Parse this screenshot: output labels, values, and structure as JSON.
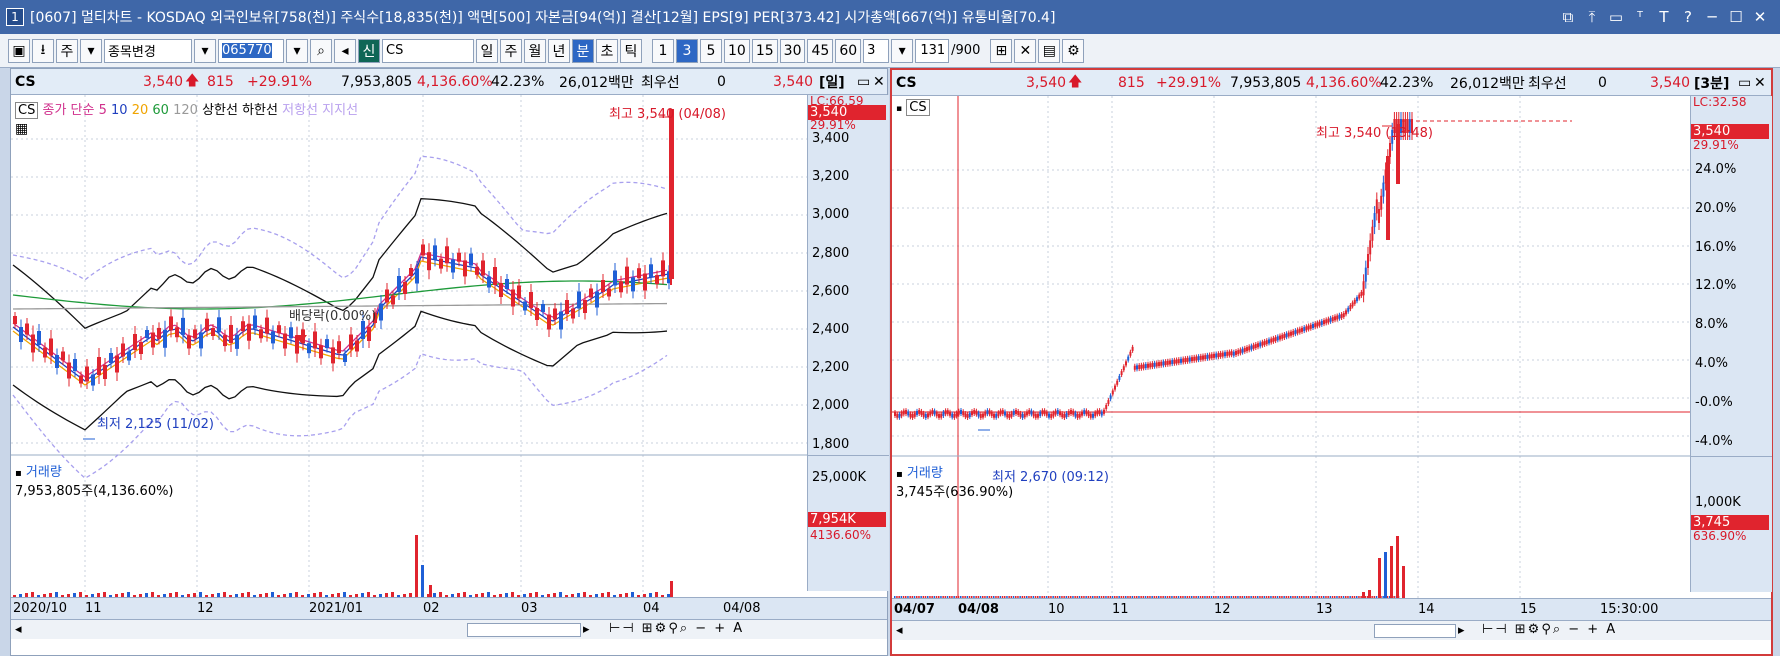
{
  "titlebar": {
    "num": "1",
    "text": "[0607] 멀티차트 - KOSDAQ 외국인보유[758(천)] 주식수[18,835(천)] 액면[500] 자본금[94(억)] 결산[12월] EPS[9] PER[373.42] 시가총액[667(억)] 유통비율[70.4]",
    "icons": [
      "restore-icon",
      "pin-icon",
      "window-icon",
      "text-icon",
      "bold-t-icon",
      "help-icon",
      "minimize-icon",
      "maximize-icon",
      "close-icon"
    ]
  },
  "toolbar": {
    "ju": "주",
    "combo": "종목변경",
    "code": "065770",
    "shin": "신",
    "name": "CS",
    "periods": [
      "일",
      "주",
      "월",
      "년",
      "분",
      "초",
      "틱"
    ],
    "nums": [
      "1",
      "3",
      "5",
      "10",
      "15",
      "30",
      "45",
      "60"
    ],
    "sel_period": "분",
    "sel_num": "3",
    "mult": "3",
    "count": "131",
    "total": "/900"
  },
  "left": {
    "info": {
      "name": "CS",
      "price": "3,540",
      "change": "815",
      "pct": "+29.91%",
      "vol": "7,953,805",
      "volpct": "4,136.60%",
      "turn": "42.23%",
      "amt": "26,012백만",
      "bid_label": "최우선",
      "bid": "0",
      "ask": "3,540",
      "period": "[일]"
    },
    "legend": {
      "cs": "CS",
      "ma_label": "종가 단순",
      "ma": [
        "5",
        "10",
        "20",
        "60",
        "120"
      ],
      "upper": "상한선",
      "lower": "하한선",
      "res": "저항선",
      "sup": "지지선"
    },
    "annot": {
      "high": "최고 3,540 (04/08)",
      "low": "최저 2,125 (11/02)",
      "div": "배당락(0.00%)"
    },
    "scale_tags": {
      "lc": "LC:66.59",
      "price": "3,540",
      "pct": "29.91%"
    },
    "yticks": [
      "3,400",
      "3,200",
      "3,000",
      "2,800",
      "2,600",
      "2,400",
      "2,200",
      "2,000",
      "1,800"
    ],
    "vol_legend": {
      "title": "거래량",
      "text": "7,953,805주(4,136.60%)"
    },
    "vol_ticks": [
      "25,000K"
    ],
    "vol_tags": {
      "v": "7,954K",
      "p": "4136.60%"
    },
    "xticks": [
      "2020/10",
      "11",
      "12",
      "2021/01",
      "02",
      "03",
      "04",
      "04/08"
    ]
  },
  "right": {
    "info": {
      "name": "CS",
      "price": "3,540",
      "change": "815",
      "pct": "+29.91%",
      "vol": "7,953,805",
      "volpct": "4,136.60%",
      "turn": "42.23%",
      "amt": "26,012백만",
      "bid_label": "최우선",
      "bid": "0",
      "ask": "3,540",
      "period": "[3분]"
    },
    "legend": {
      "cs": "CS"
    },
    "annot": {
      "high": "최고 3,540 (13:48)",
      "low": "최저 2,670 (09:12)"
    },
    "scale_tags": {
      "lc": "LC:32.58",
      "price": "3,540",
      "pct": "29.91%"
    },
    "yticks": [
      "24.0%",
      "20.0%",
      "16.0%",
      "12.0%",
      "8.0%",
      "4.0%",
      "-0.0%",
      "-4.0%"
    ],
    "vol_legend": {
      "title": "거래량",
      "text": "3,745주(636.90%)"
    },
    "vol_ticks": [
      "1,000K"
    ],
    "vol_tags": {
      "v": "3,745",
      "p": "636.90%"
    },
    "xticks": [
      "04/07",
      "04/08",
      "10",
      "11",
      "12",
      "13",
      "14",
      "15",
      "15:30:00"
    ]
  },
  "colors": {
    "up": "#e0242e",
    "down": "#1f5fd6",
    "ma5": "#d0308c",
    "ma10": "#1f3fbf",
    "ma20": "#f0a400",
    "ma60": "#1e9a3a",
    "ma120": "#9a9a9a",
    "env": "#a8a0ee"
  }
}
